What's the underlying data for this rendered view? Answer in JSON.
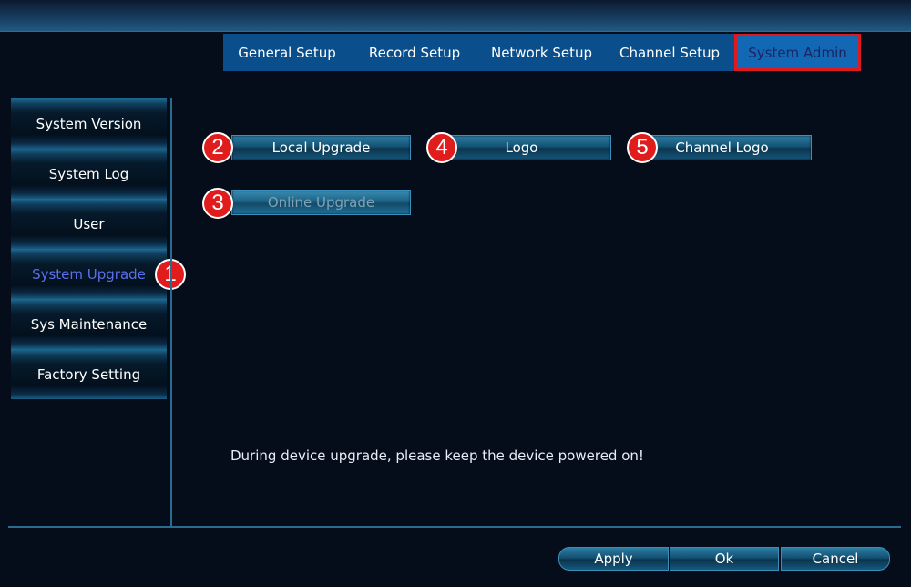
{
  "tabs": [
    {
      "label": "General Setup"
    },
    {
      "label": "Record Setup"
    },
    {
      "label": "Network Setup"
    },
    {
      "label": "Channel Setup"
    },
    {
      "label": "System Admin",
      "active": true
    }
  ],
  "sidebar": {
    "items": [
      {
        "label": "System Version"
      },
      {
        "label": "System Log"
      },
      {
        "label": "User"
      },
      {
        "label": "System Upgrade",
        "active": true
      },
      {
        "label": "Sys Maintenance"
      },
      {
        "label": "Factory Setting"
      }
    ]
  },
  "main": {
    "local_upgrade": "Local Upgrade",
    "logo": "Logo",
    "channel_logo": "Channel Logo",
    "online_upgrade": "Online Upgrade",
    "notice": "During device upgrade, please keep the device powered on!"
  },
  "badges": {
    "b1": "1",
    "b2": "2",
    "b3": "3",
    "b4": "4",
    "b5": "5"
  },
  "footer": {
    "apply": "Apply",
    "ok": "Ok",
    "cancel": "Cancel"
  },
  "colors": {
    "background": "#050c1a",
    "tab_bar": "#0a4f8c",
    "active_highlight": "#e0191e",
    "active_sidebar_text": "#5c6fe8",
    "badge": "#e11c1c"
  }
}
